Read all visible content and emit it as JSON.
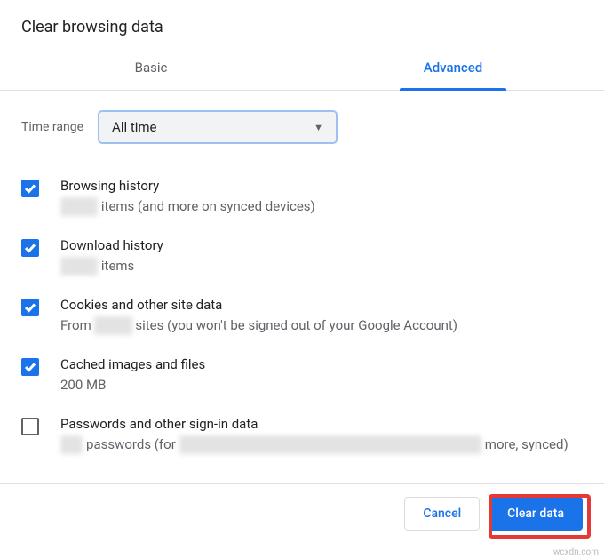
{
  "dialog": {
    "title": "Clear browsing data"
  },
  "tabs": {
    "basic": "Basic",
    "advanced": "Advanced"
  },
  "time_range": {
    "label": "Time range",
    "value": "All time"
  },
  "items": {
    "browsing": {
      "title": "Browsing history",
      "suffix": "items (and more on synced devices)"
    },
    "download": {
      "title": "Download history",
      "suffix": "items"
    },
    "cookies": {
      "title": "Cookies and other site data",
      "prefix": "From",
      "suffix": "sites (you won't be signed out of your Google Account)"
    },
    "cache": {
      "title": "Cached images and files",
      "sub": "200 MB"
    },
    "passwords": {
      "title": "Passwords and other sign-in data",
      "middle": "passwords (for",
      "suffix": "more, synced)"
    }
  },
  "footer": {
    "cancel": "Cancel",
    "clear": "Clear data"
  },
  "watermark": "wcxdn.com"
}
